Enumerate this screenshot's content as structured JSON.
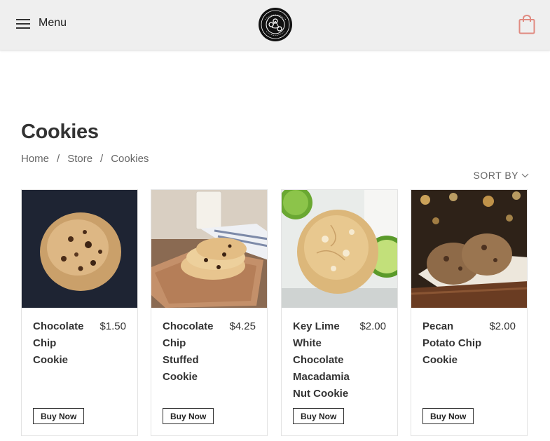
{
  "header": {
    "menu_label": "Menu",
    "logo_icon": "cupcake-logo",
    "cart_icon": "shopping-bag-icon",
    "accent_color": "#e08a80"
  },
  "page": {
    "title": "Cookies",
    "breadcrumb": [
      "Home",
      "Store",
      "Cookies"
    ],
    "breadcrumb_separator": "/",
    "sort_label": "SORT BY"
  },
  "products": [
    {
      "name": "Chocolate Chip Cookie",
      "price": "$1.50",
      "button": "Buy Now",
      "image": "chocolate-chip-cookie-photo"
    },
    {
      "name": "Chocolate Chip Stuffed Cookie",
      "price": "$4.25",
      "button": "Buy Now",
      "image": "stuffed-cookie-photo"
    },
    {
      "name": "Key Lime White Chocolate Macadamia Nut Cookie",
      "price": "$2.00",
      "button": "Buy Now",
      "image": "key-lime-cookie-photo"
    },
    {
      "name": "Pecan Potato Chip Cookie",
      "price": "$2.00",
      "button": "Buy Now",
      "image": "pecan-cookie-photo"
    }
  ]
}
